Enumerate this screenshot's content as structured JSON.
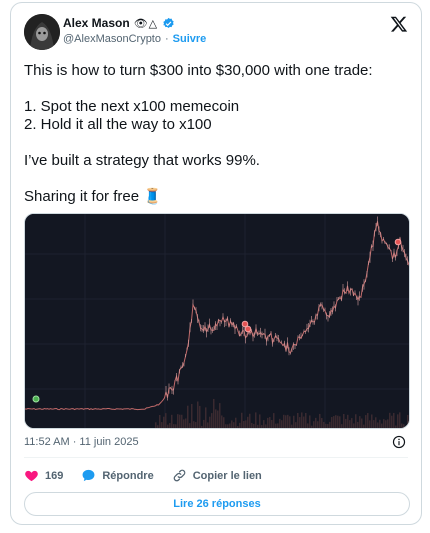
{
  "author": {
    "name": "Alex Mason",
    "name_emojis": "👁△",
    "handle": "@AlexMasonCrypto",
    "separator": "·",
    "follow_label": "Suivre"
  },
  "tweet": {
    "text": "This is how to turn $300 into $30,000 with one trade:\n\n1. Spot the next x100 memecoin\n2. Hold it all the way to x100\n\nI’ve built a strategy that works 99%.\n\nSharing it for free 🧵",
    "timestamp": "11:52 AM · 11 juin 2025"
  },
  "actions": {
    "likes_count": "169",
    "reply_label": "Répondre",
    "copy_link_label": "Copier le lien"
  },
  "replies_button": "Lire 26 réponses",
  "icons": {
    "like": "heart-icon",
    "reply": "reply-bubble-icon",
    "copy": "link-icon",
    "info": "info-icon",
    "brand": "x-logo-icon",
    "verified": "verified-badge-icon"
  },
  "colors": {
    "accent": "#1d9bf0",
    "like": "#f91880",
    "chart_bg": "#131722",
    "candle": "#c26a6a"
  }
}
